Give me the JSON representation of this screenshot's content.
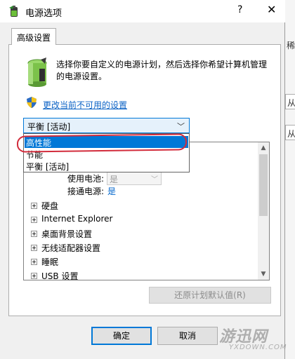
{
  "window": {
    "title": "电源选项",
    "help_glyph": "?",
    "close_glyph": "✕"
  },
  "tab": {
    "label": "高级设置"
  },
  "description": "选择你要自定义的电源计划，然后选择你希望计算机管理的电源设置。",
  "change_link": "更改当前不可用的设置",
  "plan_select": {
    "value": "平衡 [活动]",
    "options": [
      "高性能",
      "节能",
      "平衡 [活动]"
    ],
    "highlighted_index": 0
  },
  "tree": {
    "sub_settings": [
      {
        "label": "使用电池:",
        "value": "是",
        "disabled": true
      },
      {
        "label": "接通电源:",
        "value": "是",
        "disabled": false
      }
    ],
    "items": [
      "硬盘",
      "Internet Explorer",
      "桌面背景设置",
      "无线适配器设置",
      "睡眠",
      "USB 设置"
    ]
  },
  "restore_button": "还原计划默认值(R)",
  "buttons": {
    "ok": "确定",
    "cancel": "取消"
  },
  "background_window": {
    "glyphs": [
      "稀",
      "从",
      "从"
    ]
  },
  "watermark": {
    "main": "游迅网",
    "sub": "YXDOWN.COM"
  },
  "colors": {
    "accent": "#0078d7",
    "link": "#0b62c5",
    "annotation_red": "#d22c3c"
  }
}
